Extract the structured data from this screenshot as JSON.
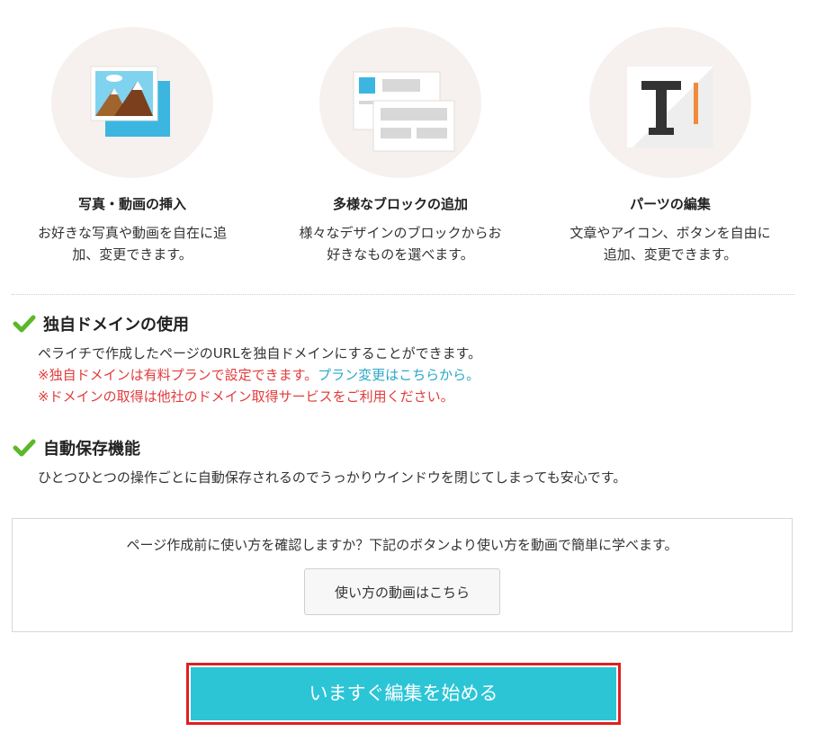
{
  "features": [
    {
      "title": "写真・動画の挿入",
      "desc_line1": "お好きな写真や動画を自在に追",
      "desc_line2": "加、変更できます。",
      "icon": "image-icon"
    },
    {
      "title": "多様なブロックの追加",
      "desc_line1": "様々なデザインのブロックからお",
      "desc_line2": "好きなものを選べます。",
      "icon": "blocks-icon"
    },
    {
      "title": "パーツの編集",
      "desc_line1": "文章やアイコン、ボタンを自由に",
      "desc_line2": "追加、変更できます。",
      "icon": "text-edit-icon"
    }
  ],
  "domain_section": {
    "title": "独自ドメインの使用",
    "line1": "ペライチで作成したページのURLを独自ドメインにすることができます。",
    "note1": "※独自ドメインは有料プランで設定できます。",
    "note1_link": "プラン変更はこちらから。",
    "note2": "※ドメインの取得は他社のドメイン取得サービスをご利用ください。"
  },
  "autosave_section": {
    "title": "自動保存機能",
    "line1": "ひとつひとつの操作ごとに自動保存されるのでうっかりウインドウを閉じてしまっても安心です。"
  },
  "howto": {
    "text": "ページ作成前に使い方を確認しますか？下記のボタンより使い方を動画で簡単に学べます。",
    "button_label": "使い方の動画はこちら"
  },
  "start_button_label": "いますぐ編集を始める",
  "colors": {
    "accent": "#2bc5d6",
    "check": "#5cb82a",
    "note_red": "#e23b3b",
    "link_blue": "#2aa7c9",
    "highlight_border": "#e02020"
  }
}
